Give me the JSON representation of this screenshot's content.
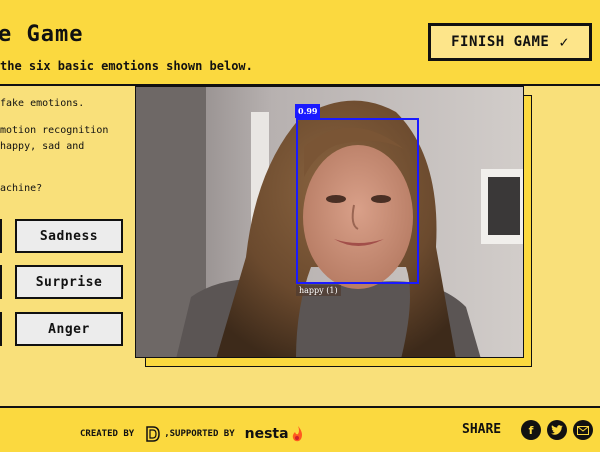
{
  "header": {
    "title": "e Game",
    "subtitle": "the six basic emotions shown below.",
    "finish_label": "FINISH GAME"
  },
  "intro": {
    "line1": "fake emotions.",
    "line2": "motion recognition",
    "line3": " happy, sad and",
    "line4": "achine?"
  },
  "emotion_buttons": [
    "Sadness",
    "Surprise",
    "Anger"
  ],
  "camera": {
    "confidence": "0.99",
    "detected_label": "happy (1)"
  },
  "footer": {
    "created_by": "CREATED BY",
    "supported_by": ",SUPPORTED BY",
    "sponsor": "nesta",
    "share_label": "SHARE"
  },
  "icons": {
    "check": "check-icon",
    "facebook": "facebook-icon",
    "twitter": "twitter-icon",
    "email": "email-icon"
  },
  "colors": {
    "header_bg": "#fbd93f",
    "body_bg": "#f9e07a",
    "detection_blue": "#1a1aff"
  }
}
